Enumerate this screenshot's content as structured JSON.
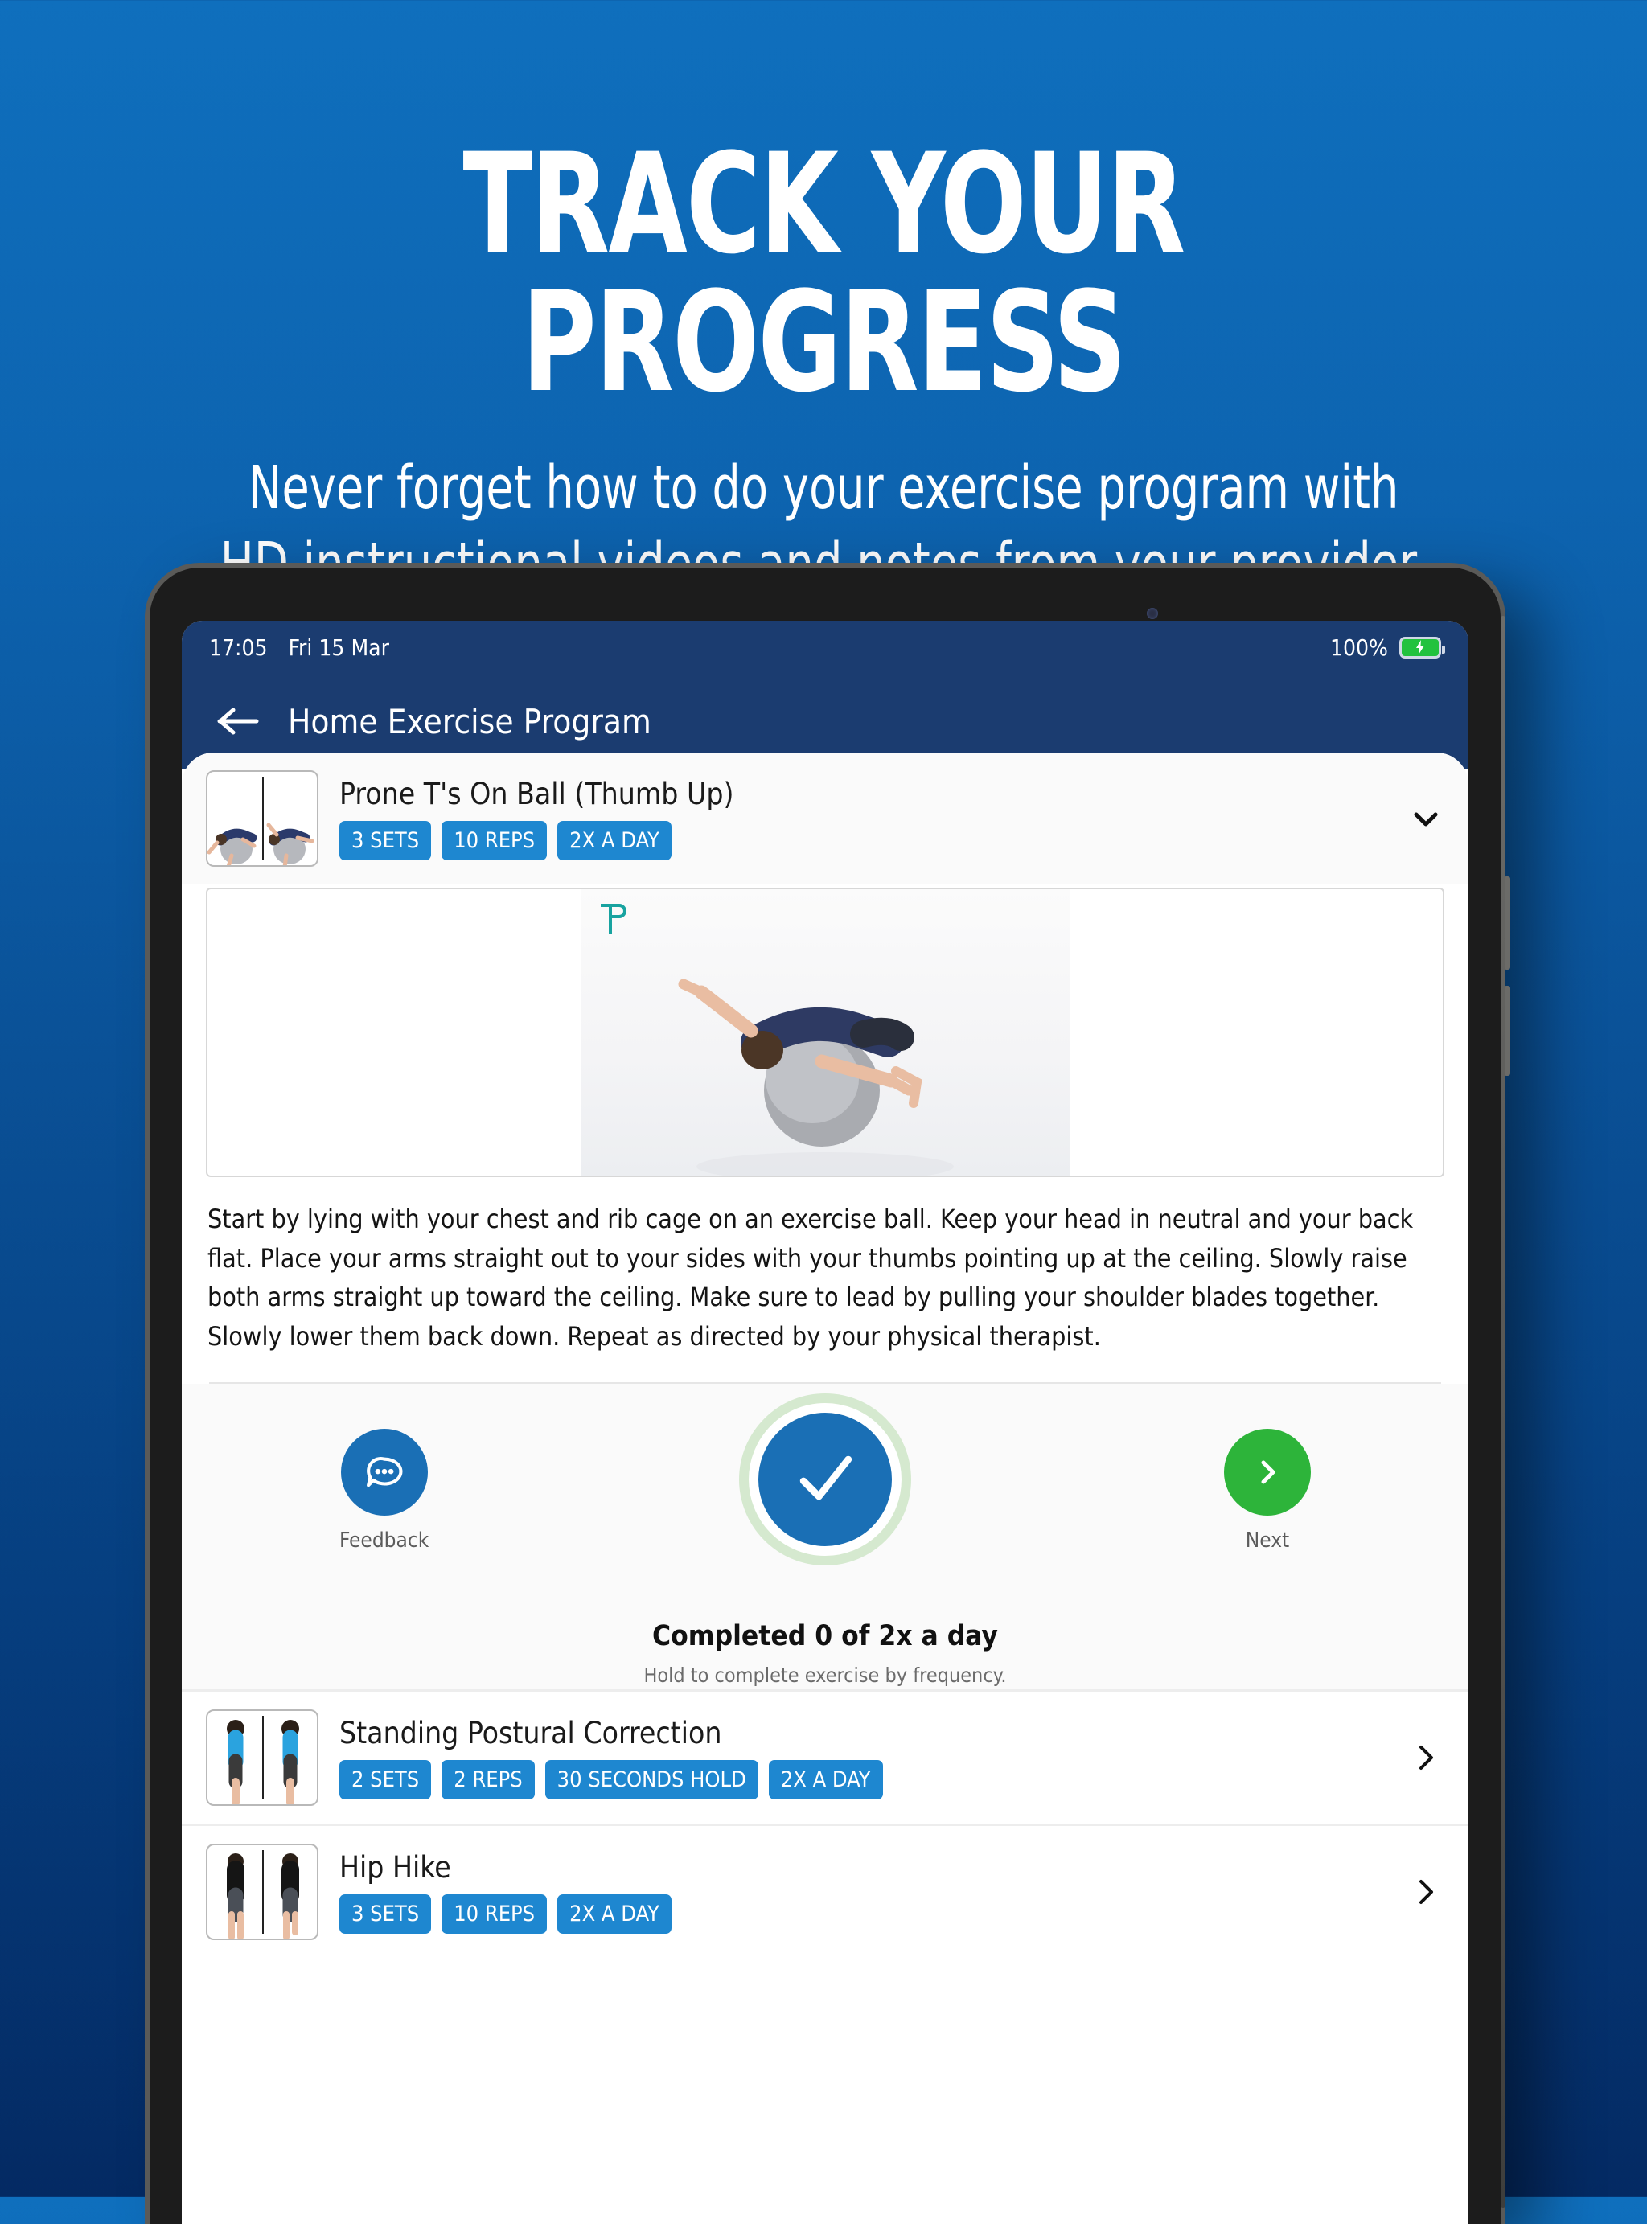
{
  "promo": {
    "title": "TRACK YOUR PROGRESS",
    "subtitle": "Never forget how to do your exercise program with\nHD instructional videos and notes from your provider."
  },
  "status_bar": {
    "time": "17:05",
    "date": "Fri 15 Mar",
    "battery_percent": "100%",
    "battery_icon": "battery-charging-icon"
  },
  "nav": {
    "back_icon": "arrow-left-icon",
    "title": "Home Exercise Program"
  },
  "colors": {
    "brand_blue": "#1e87d0",
    "nav_navy": "#1b3c70",
    "accent_green": "#2db43a",
    "check_blue": "#1a6fb5",
    "ring_green": "#d5e9cf",
    "watermark_teal": "#1aa0a0"
  },
  "active_exercise": {
    "name": "Prone T's On Ball (Thumb Up)",
    "badges": [
      "3 SETS",
      "10 REPS",
      "2X A DAY"
    ],
    "expand_icon": "chevron-down-icon",
    "thumbnail_icon": "exercise-thumbnail",
    "video_watermark": "provider-logo-watermark",
    "description": "Start by lying with your chest and rib cage on an exercise ball. Keep your head in neutral and your back flat. Place your arms straight out to your sides with your thumbs pointing up at the ceiling. Slowly raise both arms straight up toward the ceiling. Make sure to lead by pulling your shoulder blades together. Slowly lower them back down. Repeat as directed by your physical therapist.",
    "actions": {
      "feedback": {
        "label": "Feedback",
        "icon": "chat-bubble-icon"
      },
      "complete": {
        "icon": "checkmark-icon"
      },
      "next": {
        "label": "Next",
        "icon": "chevron-right-icon"
      }
    },
    "completion": {
      "status": "Completed 0 of 2x a day",
      "hint": "Hold to complete exercise by frequency."
    }
  },
  "exercise_list": [
    {
      "name": "Standing Postural Correction",
      "badges": [
        "2 SETS",
        "2 REPS",
        "30 SECONDS HOLD",
        "2X A DAY"
      ],
      "chevron_icon": "chevron-right-icon"
    },
    {
      "name": "Hip Hike",
      "badges": [
        "3 SETS",
        "10 REPS",
        "2X A DAY"
      ],
      "chevron_icon": "chevron-right-icon"
    }
  ]
}
